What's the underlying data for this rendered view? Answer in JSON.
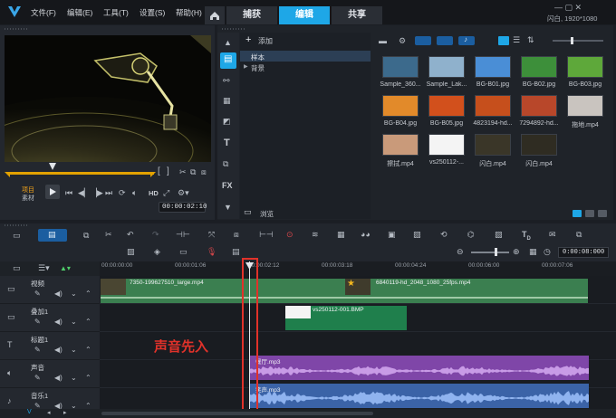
{
  "titlebar": {
    "menu": [
      "文件(F)",
      "编辑(E)",
      "工具(T)",
      "设置(S)",
      "帮助(H)"
    ],
    "tabs": [
      "捕获",
      "编辑",
      "共享"
    ],
    "active_tab": "编辑",
    "project_info": "闪白, 1920*1080"
  },
  "preview": {
    "mode_project": "项目",
    "mode_clip": "素材",
    "hd_label": "HD",
    "timecode": "00:00:02:10",
    "bracket_in": "[",
    "bracket_out": "]"
  },
  "library": {
    "add_label": "添加",
    "tree": [
      "样本",
      "背景"
    ],
    "browse_label": "浏览",
    "items": [
      {
        "name": "Sample_360...",
        "thumb": "#3c6a8c"
      },
      {
        "name": "Sample_Lak...",
        "thumb": "#8fb1cc"
      },
      {
        "name": "BG-B01.jpg",
        "thumb": "#4a8ed6"
      },
      {
        "name": "BG-B02.jpg",
        "thumb": "#3d8f3a"
      },
      {
        "name": "BG-B03.jpg",
        "thumb": "#5ea83a"
      },
      {
        "name": "BG-B04.jpg",
        "thumb": "#e28a2a"
      },
      {
        "name": "BG-B05.jpg",
        "thumb": "#d2501c"
      },
      {
        "name": "4823194-hd...",
        "thumb": "#c64f1c"
      },
      {
        "name": "7294892-hd...",
        "thumb": "#b8472a"
      },
      {
        "name": "拖地.mp4",
        "thumb": "#c9c4bf"
      },
      {
        "name": "擦拭.mp4",
        "thumb": "#c99a7a"
      },
      {
        "name": "vs250112-...",
        "thumb": "#f4f4f4"
      },
      {
        "name": "闪白.mp4",
        "thumb": "#3a3628"
      },
      {
        "name": "闪白.mp4",
        "thumb": "#2f2c22"
      }
    ]
  },
  "timeline": {
    "zoom_time": "0:00:08:000",
    "ruler_ticks": [
      "00:00:00:00",
      "00:00:01:06",
      "00:00:02:12",
      "00:00:03:18",
      "00:00:04:24",
      "00:00:06:00",
      "00:00:07:06"
    ],
    "tracks": [
      {
        "name": "视频"
      },
      {
        "name": "叠加1"
      },
      {
        "name": "标题1"
      },
      {
        "name": "声音"
      },
      {
        "name": "音乐1"
      }
    ],
    "clips": {
      "video1": "7350-199627510_large.mp4",
      "video2": "6840119-hd_2048_1080_25fps.mp4",
      "overlay": "vs250112-001.BMP",
      "voice": "餐厅.mp3",
      "music": "笑声.mp3"
    },
    "annotation": "声音先入",
    "colors": {
      "video_clip": "#3b7f50",
      "overlay_clip": "#1f7f4c",
      "voice_clip": "#7f46a8",
      "music_clip": "#3b63a7",
      "annotation": "#e1322a",
      "accent": "#1ea7e7"
    }
  }
}
